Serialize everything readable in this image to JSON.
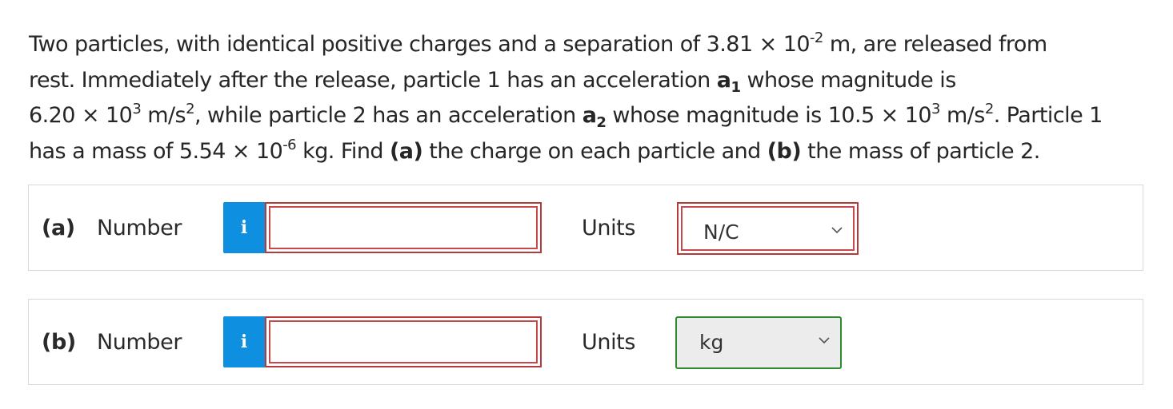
{
  "problem": {
    "line1": {
      "t1": "Two particles, with identical positive charges and a separation of 3.81 × 10",
      "exp": "-2",
      "t2": " m, are released from"
    },
    "line2": {
      "t1": "rest. Immediately after the release, particle 1 has an acceleration ",
      "accel": "a",
      "sub": "1",
      "t2": " whose magnitude is"
    },
    "line3": {
      "t1": "6.20 × 10",
      "exp1": "3",
      "t2": " m/s",
      "exp2": "2",
      "t3": ", while particle 2 has an acceleration ",
      "accel": "a",
      "sub": "2",
      "t4": " whose magnitude is 10.5 × 10",
      "exp3": "3",
      "t5": " m/s",
      "exp4": "2",
      "t6": ". Particle 1"
    },
    "line4": {
      "t1": "has a mass of 5.54 × 10",
      "exp": "-6",
      "t2": " kg. Find ",
      "part_a": "(a)",
      "t3": " the charge on each particle and ",
      "part_b": "(b)",
      "t4": " the mass of particle 2."
    }
  },
  "answers": [
    {
      "part": "(a)",
      "number_label": "Number",
      "info_icon": "i",
      "value": "",
      "units_label": "Units",
      "units_selected": "N/C",
      "input_border_color": "#b73a3a",
      "select_border_color": "#b73a3a"
    },
    {
      "part": "(b)",
      "number_label": "Number",
      "info_icon": "i",
      "value": "",
      "units_label": "Units",
      "units_selected": "kg",
      "input_border_color": "#b73a3a",
      "select_border_color": "#2f8a2f"
    }
  ],
  "colors": {
    "info_button": "#0e8fe0",
    "row_border": "#d8d8d8"
  },
  "icons": {
    "info": "info-icon",
    "dropdown": "chevron-down-icon"
  }
}
